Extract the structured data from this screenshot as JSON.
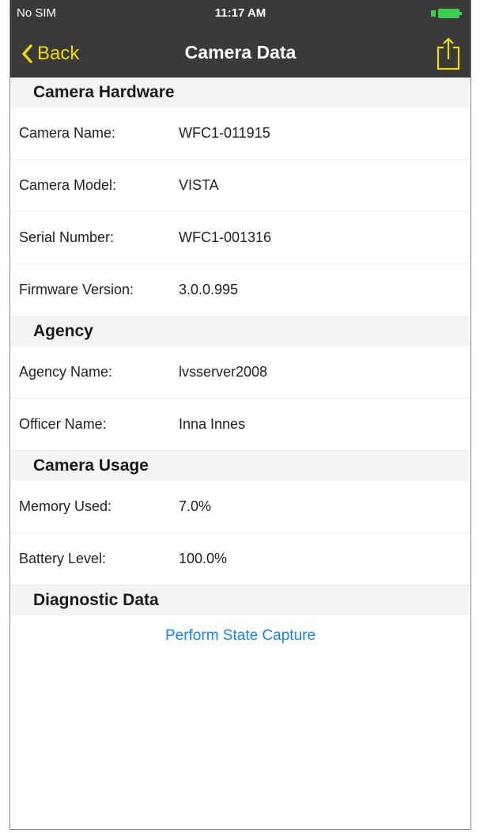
{
  "status_bar": {
    "carrier": "No SIM",
    "time": "11:17 AM",
    "battery_color": "#3ccf4e"
  },
  "nav": {
    "back_label": "Back",
    "title": "Camera Data",
    "accent_color": "#f2d90f",
    "share_icon": "share-icon"
  },
  "sections": {
    "hardware": {
      "title": "Camera Hardware",
      "rows": [
        {
          "label": "Camera Name:",
          "value": "WFC1-011915"
        },
        {
          "label": "Camera Model:",
          "value": "VISTA"
        },
        {
          "label": "Serial Number:",
          "value": "WFC1-001316"
        },
        {
          "label": "Firmware Version:",
          "value": "3.0.0.995"
        }
      ]
    },
    "agency": {
      "title": "Agency",
      "rows": [
        {
          "label": "Agency Name:",
          "value": "lvsserver2008"
        },
        {
          "label": "Officer Name:",
          "value": "Inna Innes"
        }
      ]
    },
    "usage": {
      "title": "Camera Usage",
      "rows": [
        {
          "label": "Memory Used:",
          "value": "7.0%"
        },
        {
          "label": "Battery Level:",
          "value": "100.0%"
        }
      ]
    },
    "diagnostic": {
      "title": "Diagnostic Data",
      "action_label": "Perform State Capture"
    }
  }
}
